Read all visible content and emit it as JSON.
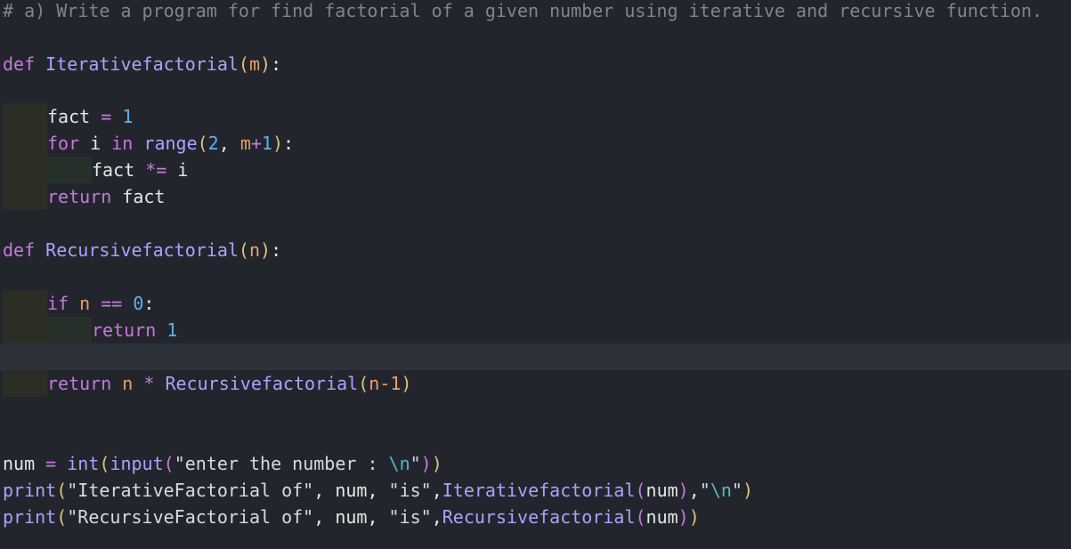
{
  "editor": {
    "language": "python",
    "colors": {
      "background": "#22262c",
      "current_line": "#2c313a",
      "keyword": "#c678dd",
      "function": "#a9a3ff",
      "parameter": "#ef9e63",
      "number": "#61afef",
      "comment": "#7f848e",
      "bracket": "#e5c07b"
    }
  },
  "code": {
    "comment": "# a) Write a program for find factorial of a given number using iterative and recursive function.",
    "l1": {
      "kw": "def",
      "fn": "Iterativefactorial",
      "open": "(",
      "param": "m",
      "close": ")",
      "colon": ":"
    },
    "l2": {
      "var": "fact",
      "op": "=",
      "num": "1"
    },
    "l3": {
      "kw1": "for",
      "var": "i",
      "kw2": "in",
      "fn": "range",
      "open": "(",
      "num1": "2",
      "comma": ",",
      "param": "m",
      "plus": "+",
      "num2": "1",
      "close": ")",
      "colon": ":"
    },
    "l4": {
      "var": "fact",
      "op": "*=",
      "var2": "i"
    },
    "l5": {
      "kw": "return",
      "var": "fact"
    },
    "l6": {
      "kw": "def",
      "fn": "Recursivefactorial",
      "open": "(",
      "param": "n",
      "close": ")",
      "colon": ":"
    },
    "l7": {
      "kw": "if",
      "var": "n",
      "op": "==",
      "num": "0",
      "colon": ":"
    },
    "l8": {
      "kw": "return",
      "num": "1"
    },
    "l9": {
      "kw": "return",
      "var": "n",
      "op": "*",
      "fn": "Recursivefactorial",
      "open": "(",
      "arg": "n-1",
      "close": ")"
    },
    "l10": {
      "var": "num",
      "op": "=",
      "fn1": "int",
      "open1": "(",
      "fn2": "input",
      "open2": "(",
      "str": "\"enter the number : ",
      "esc": "\\n",
      "strend": "\"",
      "close2": ")",
      "close1": ")"
    },
    "l11": {
      "fn": "print",
      "open": "(",
      "str1": "\"IterativeFactorial of\"",
      "c1": ",",
      "var": "num",
      "c2": ",",
      "str2": "\"is\"",
      "c3": ",",
      "fn2": "Iterativefactorial",
      "open2": "(",
      "arg": "num",
      "close2": ")",
      "c4": ",",
      "str3": "\"",
      "esc": "\\n",
      "str3end": "\"",
      "close": ")"
    },
    "l12": {
      "fn": "print",
      "open": "(",
      "str1": "\"RecursiveFactorial of\"",
      "c1": ",",
      "var": "num",
      "c2": ",",
      "str2": "\"is\"",
      "c3": ",",
      "fn2": "Recursivefactorial",
      "open2": "(",
      "arg": "num",
      "close2": ")",
      "close": ")"
    }
  }
}
